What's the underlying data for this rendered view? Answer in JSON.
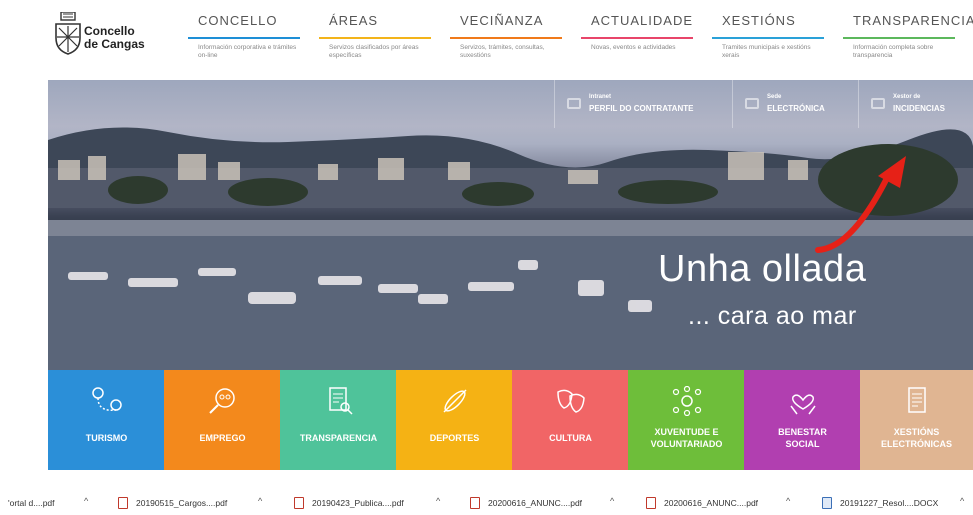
{
  "logo": {
    "line1": "Concello",
    "line2": "de Cangas"
  },
  "nav": [
    {
      "title": "CONCELLO",
      "desc": "Información corporativa e trámites on-line",
      "color": "#1e8fd6"
    },
    {
      "title": "ÁREAS",
      "desc": "Servizos clasificados por áreas específicas",
      "color": "#f3b41a"
    },
    {
      "title": "VECIÑANZA",
      "desc": "Servizos, trámites, consultas, suxestións",
      "color": "#f07a1a"
    },
    {
      "title": "ACTUALIDADE",
      "desc": "Novas, eventos e actividades",
      "color": "#e8456a"
    },
    {
      "title": "XESTIÓNS",
      "desc": "Tramites municipais e xestións xerais",
      "color": "#2aa1d8"
    },
    {
      "title": "TRANSPARENCIA",
      "desc": "Información completa sobre transparencia",
      "color": "#5cb85c"
    }
  ],
  "quick_links": [
    {
      "small": "Intranet",
      "big": "PERFIL DO CONTRATANTE",
      "icon": "card-icon"
    },
    {
      "small": "Sede",
      "big": "ELECTRÓNICA",
      "icon": "monitor-icon"
    },
    {
      "small": "Xestor de",
      "big": "INCIDENCIAS",
      "icon": "megaphone-icon"
    }
  ],
  "hero": {
    "title": "Unha ollada",
    "subtitle": "... cara ao mar"
  },
  "tiles": [
    {
      "l1": "TURISMO",
      "l2": "",
      "color": "#2b8fd8",
      "icon": "map-pins-icon"
    },
    {
      "l1": "EMPREGO",
      "l2": "",
      "color": "#f3891c",
      "icon": "search-people-icon"
    },
    {
      "l1": "TRANSPARENCIA",
      "l2": "",
      "color": "#4fc39a",
      "icon": "document-magnifier-icon"
    },
    {
      "l1": "DEPORTES",
      "l2": "",
      "color": "#f5b214",
      "icon": "canoe-icon"
    },
    {
      "l1": "CULTURA",
      "l2": "",
      "color": "#f16566",
      "icon": "theater-masks-icon"
    },
    {
      "l1": "XUVENTUDE E",
      "l2": "VOLUNTARIADO",
      "color": "#6ebe3a",
      "icon": "group-network-icon"
    },
    {
      "l1": "BENESTAR",
      "l2": "SOCIAL",
      "color": "#b13fb0",
      "icon": "heart-hands-icon"
    },
    {
      "l1": "XESTIÓNS",
      "l2": "ELECTRÓNICAS",
      "color": "#e0b592",
      "icon": "document-icon"
    }
  ],
  "downloads": [
    {
      "name": "'ortal d....pdf",
      "type": "pdf"
    },
    {
      "name": "20190515_Cargos....pdf",
      "type": "pdf"
    },
    {
      "name": "20190423_Publica....pdf",
      "type": "pdf"
    },
    {
      "name": "20200616_ANUNC....pdf",
      "type": "pdf"
    },
    {
      "name": "20200616_ANUNC....pdf",
      "type": "pdf"
    },
    {
      "name": "20191227_Resol....DOCX",
      "type": "docx"
    }
  ],
  "caret": "^"
}
